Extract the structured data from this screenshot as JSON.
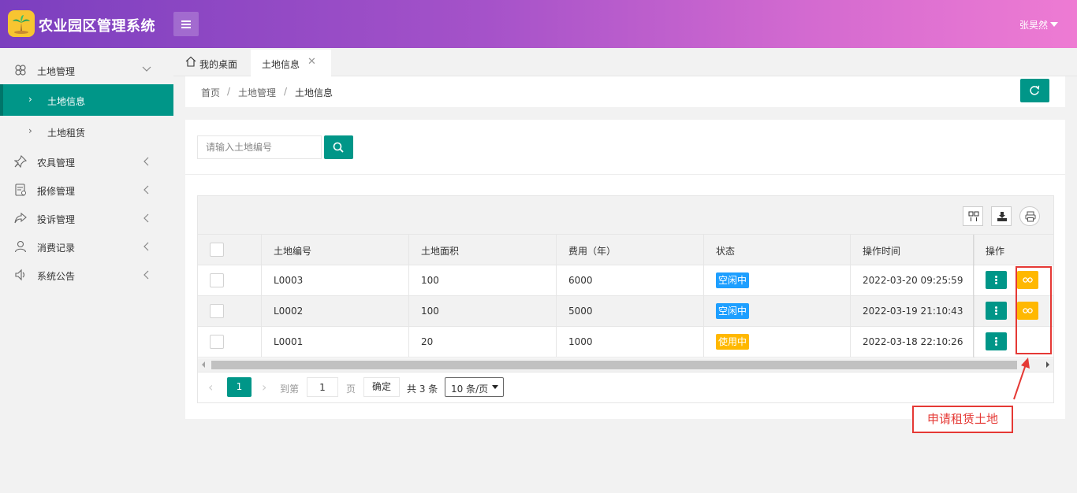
{
  "app": {
    "title": "农业园区管理系统",
    "user": "张昊然"
  },
  "sidebar": {
    "items": [
      {
        "label": "土地管理",
        "icon": "clover-icon"
      },
      {
        "label": "土地信息"
      },
      {
        "label": "土地租赁"
      },
      {
        "label": "农具管理",
        "icon": "pin-icon"
      },
      {
        "label": "报修管理",
        "icon": "repair-form-icon"
      },
      {
        "label": "投诉管理",
        "icon": "share-arrow-icon"
      },
      {
        "label": "消费记录",
        "icon": "user-icon"
      },
      {
        "label": "系统公告",
        "icon": "speaker-icon"
      }
    ]
  },
  "tabs": {
    "home": "我的桌面",
    "current": "土地信息",
    "close_glyph": "✕"
  },
  "breadcrumb": {
    "home": "首页",
    "level1": "土地管理",
    "level2": "土地信息",
    "sep": "/"
  },
  "search": {
    "placeholder": "请输入土地编号"
  },
  "table": {
    "columns": [
      "土地编号",
      "土地面积",
      "费用（年）",
      "状态",
      "操作时间",
      "操作"
    ],
    "rows": [
      {
        "code": "L0003",
        "area": "100",
        "fee": "6000",
        "status": "空闲中",
        "status_color": "#1e9fff",
        "time": "2022-03-20 09:25:59",
        "can_rent": true
      },
      {
        "code": "L0002",
        "area": "100",
        "fee": "5000",
        "status": "空闲中",
        "status_color": "#1e9fff",
        "time": "2022-03-19 21:10:43",
        "can_rent": true
      },
      {
        "code": "L0001",
        "area": "20",
        "fee": "1000",
        "status": "使用中",
        "status_color": "#ffb800",
        "time": "2022-03-18 22:10:26",
        "can_rent": false
      }
    ]
  },
  "pagination": {
    "current": "1",
    "goto_label": "到第",
    "goto_value": "1",
    "page_label": "页",
    "confirm": "确定",
    "total": "共 3 条",
    "page_size": "10 条/页"
  },
  "annotation": {
    "label": "申请租赁土地",
    "color": "#e53935"
  },
  "colors": {
    "primary": "#009688",
    "warn": "#ffb800",
    "info": "#1e9fff"
  }
}
